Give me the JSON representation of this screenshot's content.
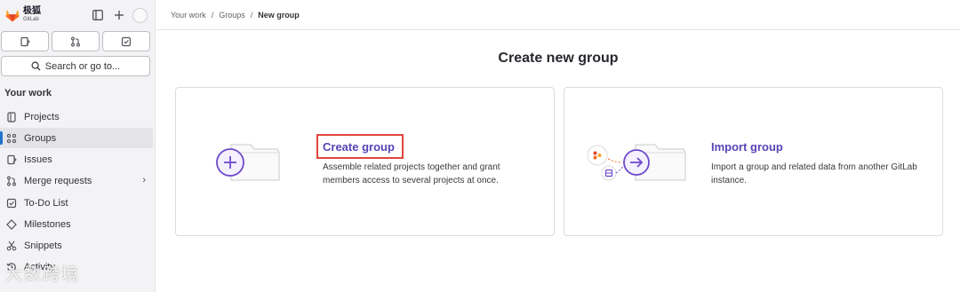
{
  "brand": {
    "name": "极狐",
    "sub": "GitLab"
  },
  "search": {
    "label": "Search or go to..."
  },
  "sidebar": {
    "section_title": "Your work",
    "items": [
      {
        "label": "Projects",
        "icon": "project-icon"
      },
      {
        "label": "Groups",
        "icon": "group-icon",
        "active": true
      },
      {
        "label": "Issues",
        "icon": "issues-icon"
      },
      {
        "label": "Merge requests",
        "icon": "merge-request-icon",
        "has_submenu": true
      },
      {
        "label": "To-Do List",
        "icon": "todo-icon"
      },
      {
        "label": "Milestones",
        "icon": "milestone-icon"
      },
      {
        "label": "Snippets",
        "icon": "snippet-icon"
      },
      {
        "label": "Activity",
        "icon": "history-icon"
      }
    ]
  },
  "watermark": "大数跨境",
  "breadcrumb": {
    "items": [
      "Your work",
      "Groups"
    ],
    "separator": "/",
    "current": "New group"
  },
  "page_title": "Create new group",
  "cards": {
    "create": {
      "title": "Create group",
      "description": "Assemble related projects together and grant members access to several projects at once."
    },
    "import": {
      "title": "Import group",
      "description": "Import a group and related data from another GitLab instance."
    }
  },
  "colors": {
    "accent": "#5943b6",
    "active_bar": "#1f75cb",
    "highlight": "#e2453c",
    "logo": "#e24329"
  }
}
